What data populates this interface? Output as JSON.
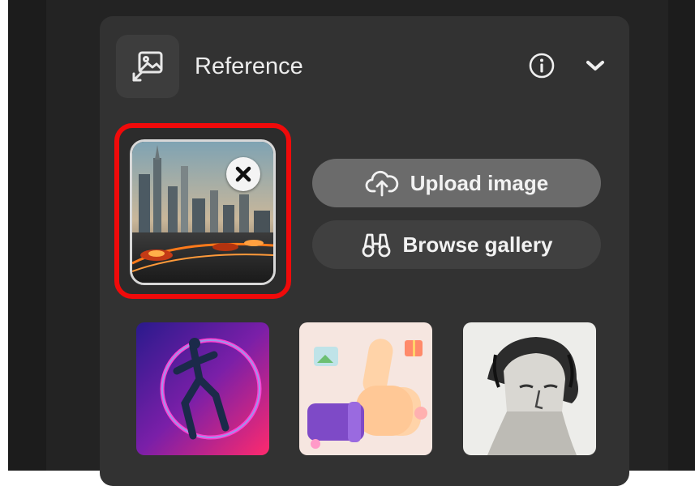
{
  "panel": {
    "title": "Reference",
    "reference_image": {
      "description_icon": "image-reference-icon"
    },
    "actions": {
      "upload_label": "Upload image",
      "browse_label": "Browse gallery"
    },
    "icons": {
      "header": "image-reference-icon",
      "info": "info-icon",
      "collapse": "chevron-down-icon",
      "remove": "close-icon",
      "upload": "cloud-upload-icon",
      "browse": "binoculars-icon"
    }
  },
  "colors": {
    "panel_bg": "#323232",
    "highlight": "#f00a0a",
    "upload_button_bg": "#6b6b6b",
    "browse_button_bg": "#404040"
  }
}
